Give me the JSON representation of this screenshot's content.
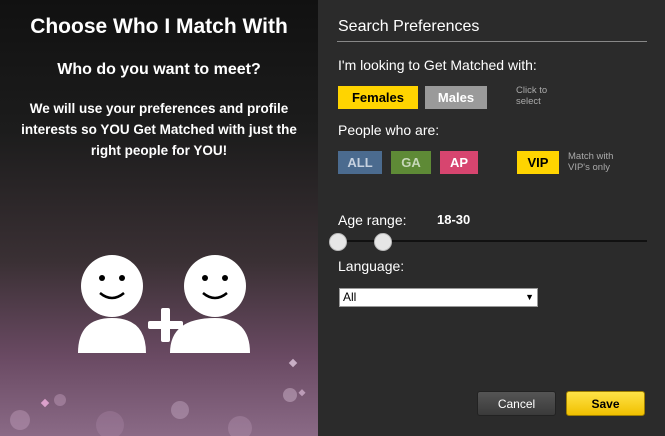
{
  "left": {
    "title": "Choose Who I Match With",
    "subtitle": "Who do you want to meet?",
    "description": "We will use your preferences and profile interests so YOU Get Matched with just the right people for YOU!"
  },
  "prefs": {
    "title": "Search Preferences",
    "looking_label": "I'm looking to Get Matched with:",
    "females": "Females",
    "males": "Males",
    "click_hint": "Click to\nselect",
    "people_label": "People who are:",
    "all": "ALL",
    "ga": "GA",
    "ap": "AP",
    "vip": "VIP",
    "vip_hint": "Match with\nVIP's only",
    "age_label": "Age range:",
    "age_value": "18-30",
    "age_min": 18,
    "age_max": 30,
    "language_label": "Language:",
    "language_value": "All"
  },
  "buttons": {
    "cancel": "Cancel",
    "save": "Save"
  },
  "colors": {
    "accent_yellow": "#ffd400",
    "males_gray": "#9a9a9a",
    "all_blue": "#4b6b8f",
    "ga_green": "#5e8a36",
    "ap_pink": "#d7456f"
  }
}
